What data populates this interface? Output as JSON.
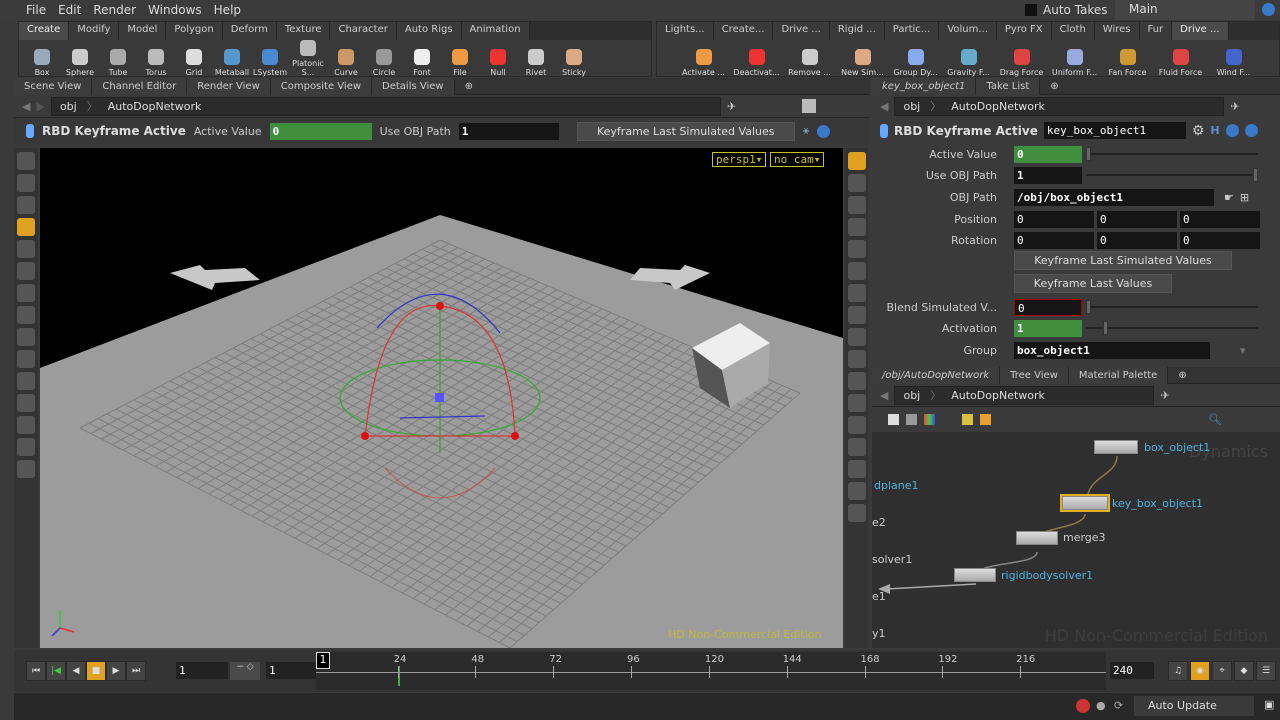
{
  "menu": [
    "File",
    "Edit",
    "Render",
    "Windows",
    "Help"
  ],
  "auto_takes": "Auto Takes",
  "take": "Main",
  "shelf_left": {
    "tabs": [
      "Create",
      "Modify",
      "Model",
      "Polygon",
      "Deform",
      "Texture",
      "Character",
      "Auto Rigs",
      "Animation"
    ],
    "tools": [
      "Box",
      "Sphere",
      "Tube",
      "Torus",
      "Grid",
      "Metaball",
      "LSystem",
      "Platonic S...",
      "Curve",
      "Circle",
      "Font",
      "File",
      "Null",
      "Rivet",
      "Sticky"
    ]
  },
  "shelf_right": {
    "tabs": [
      "Lights...",
      "Create...",
      "Drive ...",
      "Rigid ...",
      "Partic...",
      "Volum...",
      "Pyro FX",
      "Cloth",
      "Wires",
      "Fur",
      "Drive ..."
    ],
    "tools": [
      "Activate ...",
      "Deactivat...",
      "Remove ...",
      "New Sim...",
      "Group Dy...",
      "Gravity F...",
      "Drag Force",
      "Uniform F...",
      "Fan Force",
      "Fluid Force",
      "Wind F..."
    ]
  },
  "left_pane": {
    "tabs": [
      "Scene View",
      "Channel Editor",
      "Render View",
      "Composite View",
      "Details View"
    ],
    "path": [
      "obj",
      "AutoDopNetwork"
    ],
    "op_name": "RBD Keyframe Active",
    "active_label": "Active Value",
    "active_value": "0",
    "useobj_label": "Use OBJ Path",
    "useobj_value": "1",
    "keyframe_btn": "Keyframe Last Simulated Values",
    "camera": "persp1",
    "cam": "no cam",
    "watermark": "HD Non-Commercial Edition"
  },
  "params": {
    "tabs": [
      "key_box_object1",
      "Take List"
    ],
    "path": [
      "obj",
      "AutoDopNetwork"
    ],
    "op_type": "RBD Keyframe Active",
    "node_name": "key_box_object1",
    "active_value": {
      "label": "Active Value",
      "value": "0",
      "slider": 0
    },
    "use_obj": {
      "label": "Use OBJ Path",
      "value": "1",
      "slider": 1
    },
    "obj_path": {
      "label": "OBJ Path",
      "value": "/obj/box_object1"
    },
    "position": {
      "label": "Position",
      "values": [
        "0",
        "0",
        "0"
      ]
    },
    "rotation": {
      "label": "Rotation",
      "values": [
        "0",
        "0",
        "0"
      ]
    },
    "btn_sim": "Keyframe Last Simulated Values",
    "btn_last": "Keyframe Last Values",
    "blend": {
      "label": "Blend Simulated V...",
      "value": "0",
      "slider": 0
    },
    "activation": {
      "label": "Activation",
      "value": "1",
      "slider": 0.1
    },
    "group": {
      "label": "Group",
      "value": "box_object1"
    }
  },
  "network": {
    "tabs": [
      "/obj/AutoDopNetwork",
      "Tree View",
      "Material Palette"
    ],
    "path": [
      "obj",
      "AutoDopNetwork"
    ],
    "nodes": [
      "box_object1",
      "key_box_object1",
      "merge3",
      "rigidbodysolver1"
    ],
    "partial": [
      "dplane1",
      "e2",
      "solver1",
      "e1",
      "y1"
    ],
    "context": "Dynamics",
    "watermark": "HD Non-Commercial Edition"
  },
  "timeline": {
    "frame": "1",
    "start": "1",
    "end_start": "1",
    "end": "240",
    "ticks": [
      "24",
      "48",
      "72",
      "96",
      "120",
      "144",
      "168",
      "192",
      "216"
    ],
    "current": "1",
    "cursor_frame": 24
  },
  "status": {
    "update_mode": "Auto Update"
  }
}
